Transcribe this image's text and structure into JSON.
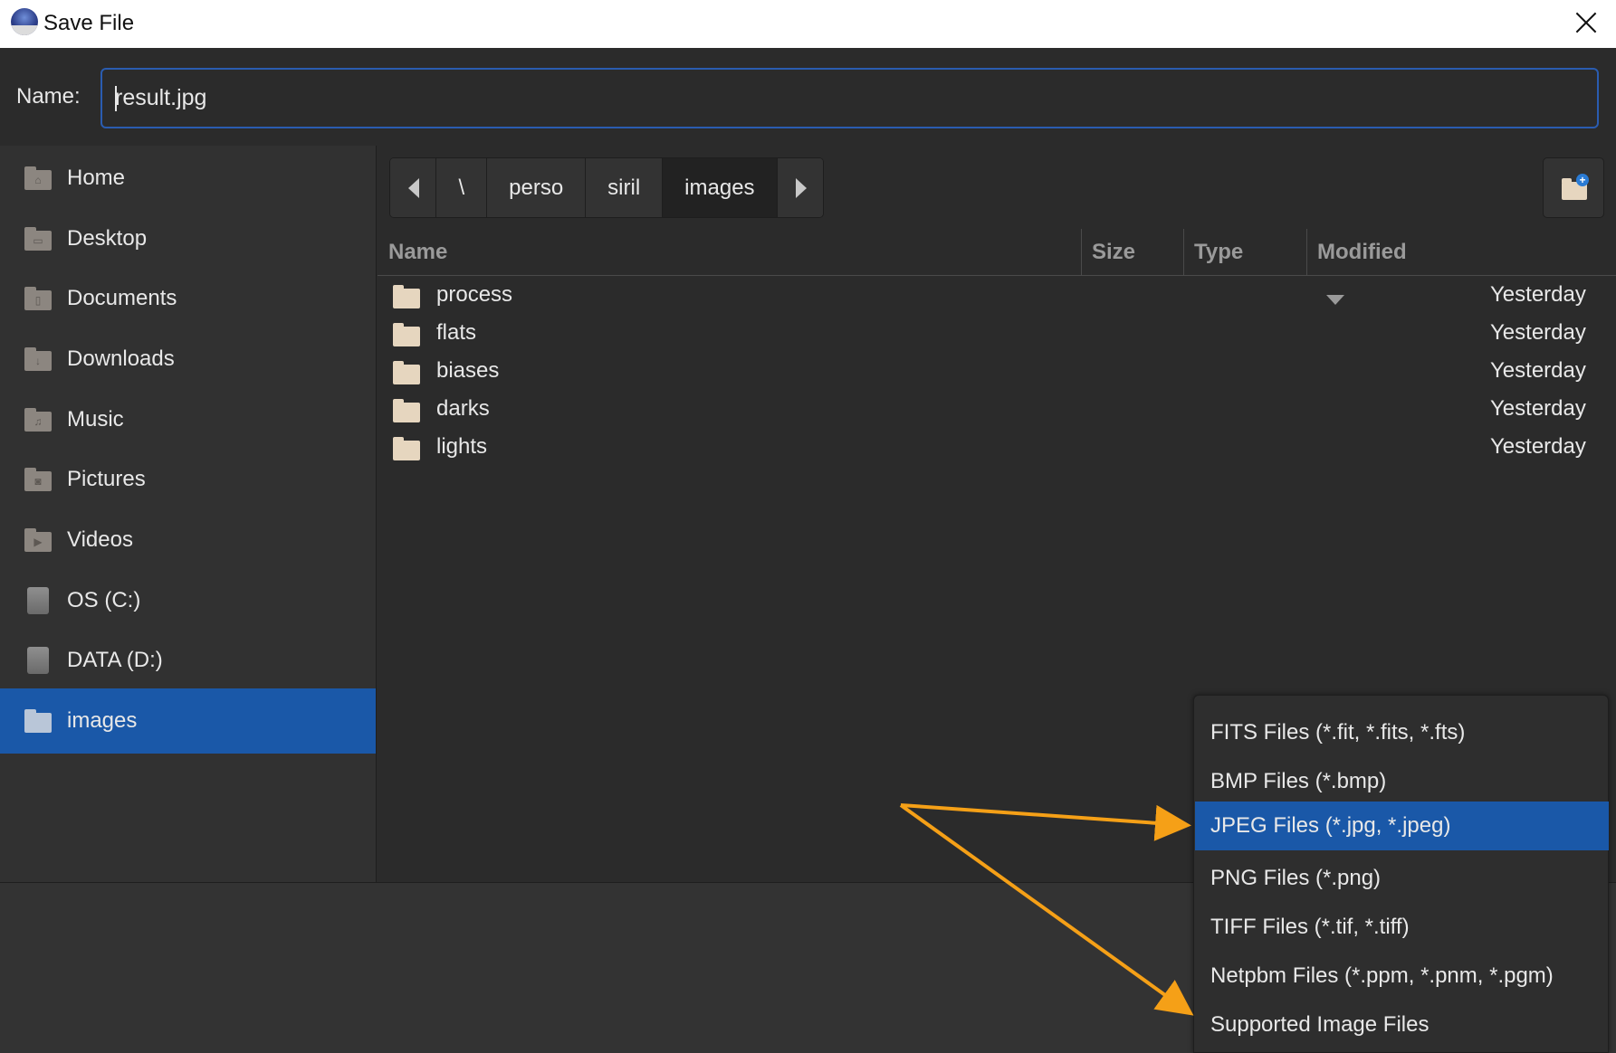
{
  "window": {
    "title": "Save File"
  },
  "name_field": {
    "label": "Name:",
    "value": "result.jpg"
  },
  "sidebar": {
    "items": [
      {
        "label": "Home",
        "icon": "home-folder-icon"
      },
      {
        "label": "Desktop",
        "icon": "desktop-folder-icon"
      },
      {
        "label": "Documents",
        "icon": "documents-folder-icon"
      },
      {
        "label": "Downloads",
        "icon": "downloads-folder-icon"
      },
      {
        "label": "Music",
        "icon": "music-folder-icon"
      },
      {
        "label": "Pictures",
        "icon": "pictures-folder-icon"
      },
      {
        "label": "Videos",
        "icon": "videos-folder-icon"
      },
      {
        "label": "OS (C:)",
        "icon": "drive-icon"
      },
      {
        "label": "DATA (D:)",
        "icon": "drive-icon"
      },
      {
        "label": "images",
        "icon": "folder-icon",
        "selected": true
      }
    ]
  },
  "pathbar": {
    "segments": [
      "\\",
      "perso",
      "siril",
      "images"
    ],
    "current": "images"
  },
  "columns": {
    "name": "Name",
    "size": "Size",
    "type": "Type",
    "modified": "Modified"
  },
  "files": [
    {
      "name": "process",
      "modified": "Yesterday"
    },
    {
      "name": "flats",
      "modified": "Yesterday"
    },
    {
      "name": "biases",
      "modified": "Yesterday"
    },
    {
      "name": "darks",
      "modified": "Yesterday"
    },
    {
      "name": "lights",
      "modified": "Yesterday"
    }
  ],
  "filter_popup": {
    "options": [
      "FITS Files (*.fit, *.fits, *.fts)",
      "BMP Files (*.bmp)",
      "JPEG Files (*.jpg, *.jpeg)",
      "PNG Files (*.png)",
      "TIFF Files (*.tif, *.tiff)",
      "Netpbm Files (*.ppm, *.pnm, *.pgm)",
      "Supported Image Files"
    ],
    "selected": "JPEG Files (*.jpg, *.jpeg)"
  },
  "colors": {
    "selection": "#1a58a8",
    "annotation_arrow": "#f5a017",
    "folder": "#e6d6bf"
  }
}
